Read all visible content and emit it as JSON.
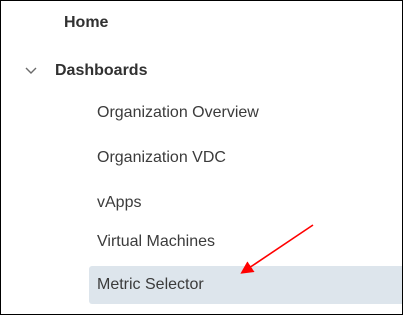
{
  "nav": {
    "home_label": "Home",
    "dashboards_label": "Dashboards",
    "dashboards_items": [
      {
        "label": "Organization Overview"
      },
      {
        "label": "Organization VDC"
      },
      {
        "label": "vApps"
      },
      {
        "label": "Virtual Machines"
      },
      {
        "label": "Metric Selector",
        "selected": true
      }
    ]
  },
  "icons": {
    "expand": "chevron-down-icon"
  },
  "colors": {
    "selected_bg": "#dde5ec",
    "annotation_arrow": "#ff0000",
    "text": "#313131"
  }
}
